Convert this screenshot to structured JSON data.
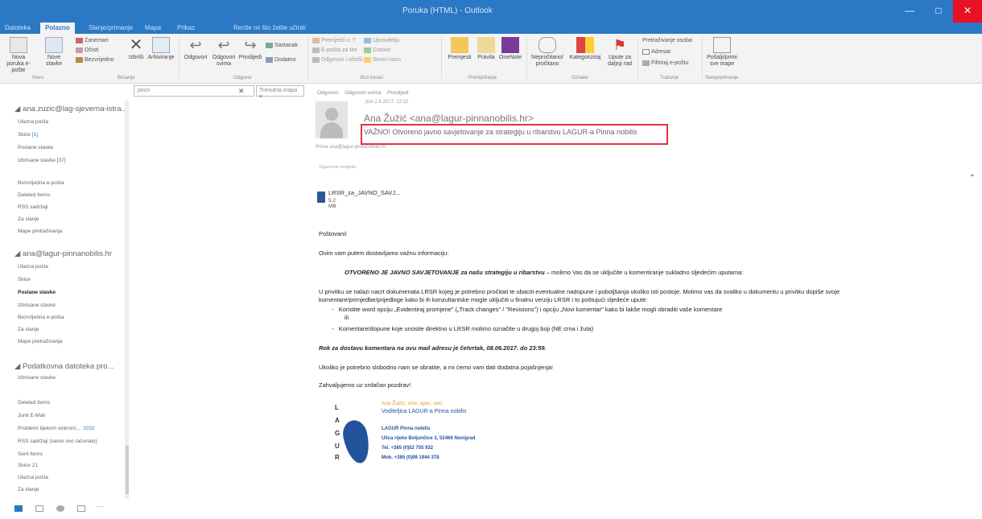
{
  "titlebar": {
    "title": "Poruka (HTML) - Outlook"
  },
  "tabs": [
    {
      "label": "Datoteka"
    },
    {
      "label": "Polazno"
    },
    {
      "label": "Slanje/primanje"
    },
    {
      "label": "Mapa"
    },
    {
      "label": "Prikaz"
    },
    {
      "label": "Recite mi što želite učiniti"
    }
  ],
  "ribbon": {
    "new_email": "Nova poruka e-pošte",
    "new_items": "Nove stavke",
    "ignore": "Zanemari",
    "clean": "Očisti",
    "junk": "Bezvrijedno",
    "delete": "Izbriši",
    "archive": "Arhiviranje",
    "reply": "Odgovori",
    "reply_all": "Odgovori svima",
    "forward": "Proslijedi",
    "meeting": "Sastanak",
    "more": "Dodatno",
    "quick1": "Premjesti u: ?",
    "quick2": "E-pošta za tim",
    "quick3": "Odgovori i izbriši",
    "quick4": "Upravitelju",
    "quick5": "Gotovo",
    "quick6": "Stvori novo",
    "move": "Premjesti",
    "rules": "Pravila",
    "onenote": "OneNote",
    "unread": "Nepročitano/ pročitano",
    "categorize": "Kategoriziraj",
    "followup": "Upute za daljnji rad",
    "search_people": "Pretraživanje osoba",
    "address_book": "Adresar",
    "filter": "Filtriraj e-poštu",
    "send_receive": "Pošalji/primi sve mape",
    "grp_new": "Novo",
    "grp_delete": "Brisanje",
    "grp_respond": "Odgovor",
    "grp_quick": "Brzi koraci",
    "grp_move": "Premještanje",
    "grp_tags": "Oznake",
    "grp_find": "Traženje",
    "grp_sendrecv": "Slanje/primanje"
  },
  "search": {
    "placeholder": "pozo",
    "scope": "Trenutna mapa"
  },
  "folders": {
    "acct1": "ana.zuzic@lag-sjeverna-istra...",
    "acct1_items": [
      {
        "label": "Ulazna pošta",
        "count": ""
      },
      {
        "label": "Skice",
        "count": "[1]"
      },
      {
        "label": "Poslane stavke",
        "count": ""
      },
      {
        "label": "Izbrisane stavke",
        "count": "[37]"
      },
      {
        "label": "Bezvrijedna e-pošta",
        "count": ""
      },
      {
        "label": "Deleted Items",
        "count": ""
      },
      {
        "label": "RSS sadržaji",
        "count": ""
      },
      {
        "label": "Za slanje",
        "count": ""
      },
      {
        "label": "Mape pretraživanja",
        "count": ""
      }
    ],
    "acct2": "ana@lagur-pinnanobilis.hr",
    "acct2_items": [
      {
        "label": "Ulazna pošta",
        "count": ""
      },
      {
        "label": "Skice",
        "count": ""
      },
      {
        "label": "Poslane stavke",
        "count": ""
      },
      {
        "label": "Izbrisane stavke",
        "count": ""
      },
      {
        "label": "Bezvrijedna e-pošta",
        "count": ""
      },
      {
        "label": "Za slanje",
        "count": ""
      },
      {
        "label": "Mape pretraživanja",
        "count": ""
      }
    ],
    "acct3": "Podatkovna datoteka pro...",
    "acct3_items": [
      {
        "label": "Izbrisane stavke",
        "count": ""
      },
      {
        "label": "Deleted Items",
        "count": ""
      },
      {
        "label": "Junk E-Mail",
        "count": ""
      },
      {
        "label": "Problemi tijekom sinkroni...",
        "count": "1032"
      },
      {
        "label": "RSS sadržaji (samo ovo računalo)",
        "count": ""
      },
      {
        "label": "Sent Items",
        "count": ""
      },
      {
        "label": "Skice",
        "count": "21"
      },
      {
        "label": "Ulazna pošta",
        "count": ""
      },
      {
        "label": "Za slanje",
        "count": ""
      }
    ]
  },
  "message": {
    "actions": [
      "Odgovori",
      "Odgovori svima",
      "Proslijedi"
    ],
    "date": "pon 2.6.2017. 12:12",
    "sender": "Ana Žužić <ana@lagur-pinnanobilis.hr>",
    "subject": "VAŽNO! Otvoreno javno savjetovanje za strategiju u ribarstvu LAGUR-a Pinna nobilis",
    "to": "Prima    ana@lagur-pinnanobilis.hr",
    "meta": "Sigurnosti nasljeđu",
    "attachment_name": "LRSR_za_JAVNO_SAVJ...",
    "attachment_size": "5,2 MB",
    "greeting": "Poštovani!",
    "line1": "Ovim vam putem dostavljamo važnu informaciju:",
    "headline": "OTVORENO JE JAVNO SAVJETOVANJE za našu strategiju u ribarstvu",
    "headline_rest": " – molimo Vas da se uključite u komentiranje sukladno sljedećim uputama:",
    "para1": "U privitku se nalazi nacrt dokumenata LRSR kojeg je potrebno pročitati te ubaciti eventualne nadopune i poboljšanja ukoliko isti postoje. Molimo vas da svaliko u dokumentu u privitku dopiše svoje",
    "para2": "komentare/primjedbe/prijedloge kako bi ih konzultantske mogle uključiti u finalnu verziju LRSR i to poštujući sljedeće upute:",
    "bullet1": "Koristite word opciju „Evidentiraj promjene\" („Track changes\" / \"Revisions\") i opciju „Novi komentar\" kako bi lakše mogli obraditi vaše komentare",
    "bullet1b": "ili",
    "bullet2": "Komentare/dopune koje unosite direktno u LRSR molimo označite u drugoj boji (NE crna i žuta)",
    "deadline": "Rok za dostavu komentara na ovu mail adresu je četvrtak, 08.06.2017. do 23:59.",
    "line2": "Ukoliko je potrebno slobodno nam se obratite, a mi ćemo vam dati dodatna pojašnjenja!",
    "closing": "Zahvaljujemo uz srdačan pozdrav!"
  },
  "signature": {
    "name": "Ana Žužić, univ. spec. oec.",
    "title": "Voditeljica LAGUR-a Pinna nobilis",
    "org": "LAGUR Pinna nobilis",
    "address": "Ulica rijeke Boljunčice 3, 52466 Novigrad",
    "tel": "Tel. +385 (0)52 755 932",
    "mob": "Mob. +385 (0)98 1944 378",
    "logo_letters": [
      "L",
      "A",
      "G",
      "U",
      "R"
    ]
  }
}
